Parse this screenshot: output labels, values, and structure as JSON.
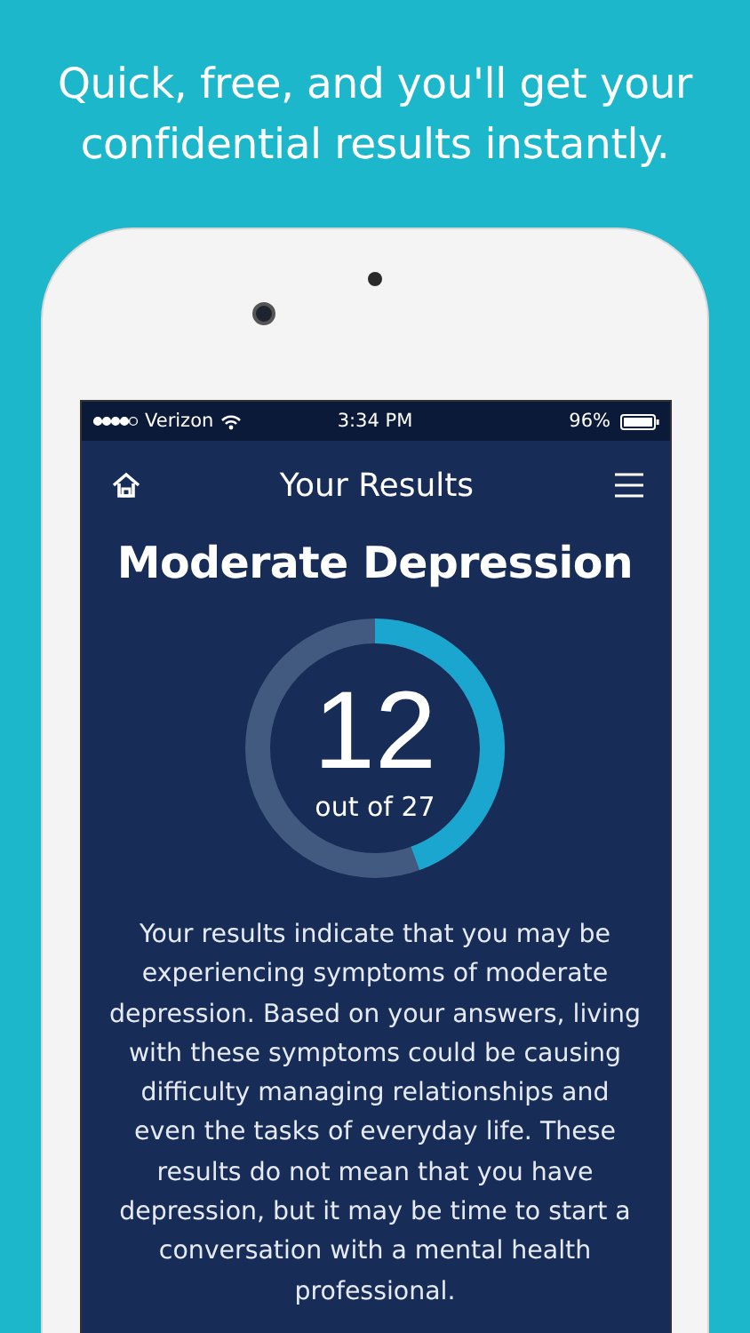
{
  "headline": "Quick, free, and you'll get your confidential results instantly.",
  "status_bar": {
    "carrier": "Verizon",
    "time": "3:34 PM",
    "battery": "96%"
  },
  "header": {
    "title": "Your Results"
  },
  "result": {
    "title": "Moderate Depression",
    "score": "12",
    "out_of": "out of 27",
    "level": 0.444
  },
  "description": "Your results indicate that you may be experiencing symptoms of moderate depression. Based on your answers, living with these symptoms could be causing difficulty managing relationships and even the tasks of everyday life. These results do not mean that you have depression, but it may be time to start a conversation with a mental health professional."
}
